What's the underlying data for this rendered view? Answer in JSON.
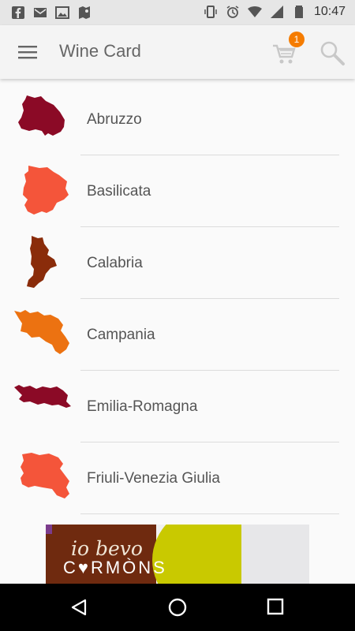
{
  "status_bar": {
    "time": "10:47",
    "left_icons": [
      "facebook-icon",
      "gmail-icon",
      "image-icon",
      "maps-icon"
    ],
    "right_icons": [
      "vibrate-icon",
      "alarm-icon",
      "wifi-icon",
      "signal-icon",
      "battery-icon"
    ]
  },
  "app_bar": {
    "title": "Wine Card",
    "cart_badge": "1"
  },
  "regions": [
    {
      "name": "Abruzzo",
      "color": "#8b0a26"
    },
    {
      "name": "Basilicata",
      "color": "#f4553a"
    },
    {
      "name": "Calabria",
      "color": "#8a2c0a"
    },
    {
      "name": "Campania",
      "color": "#ec7211"
    },
    {
      "name": "Emilia-Romagna",
      "color": "#8b0a26"
    },
    {
      "name": "Friuli-Venezia Giulia",
      "color": "#f4553a"
    }
  ],
  "ad": {
    "line1": "io bevo",
    "line2": "C♥RMÒNS"
  }
}
